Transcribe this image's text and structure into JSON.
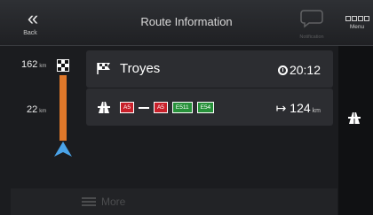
{
  "header": {
    "title": "Route Information",
    "back_label": "Back",
    "notification_label": "Notification",
    "menu_label": "Menu"
  },
  "route": {
    "items": [
      {
        "distance": "162",
        "distance_unit": "km",
        "icon": "checkered-flag-icon",
        "name": "Troyes",
        "eta": "20:12"
      },
      {
        "distance": "22",
        "distance_unit": "km",
        "icon": "motorway-icon",
        "roads": [
          "A5",
          "A5",
          "E511",
          "E54"
        ],
        "length": "124",
        "length_unit": "km"
      }
    ]
  },
  "bottom": {
    "more_label": "More"
  },
  "colors": {
    "route_line": "#e0782a",
    "position_arrow": "#4aa3e8",
    "road_red": "#c8202a",
    "road_green": "#27913a"
  }
}
